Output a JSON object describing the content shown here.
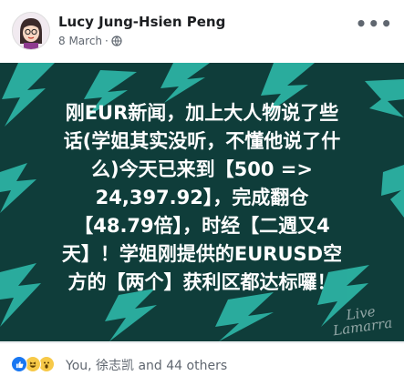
{
  "post": {
    "author": "Lucy Jung-Hsien Peng",
    "date": "8 March",
    "separator": "·",
    "privacy_icon": "globe-icon",
    "more_icon": "more-options-icon",
    "text": "刚EUR新闻，加上大人物说了些\n话(学姐其实没听，不懂他说了什\n么)今天已来到【500 =>\n24,397.92】，完成翻仓\n【48.79倍】，时经【二週又4\n天】！学姐刚提供的EURUSD空\n方的【两个】获利区都达标囉！",
    "watermark": "Live Lamarra"
  },
  "reactions": {
    "icons": [
      "like-icon",
      "haha-icon",
      "wow-icon"
    ],
    "summary": "You, 徐志凯 and 44 others"
  },
  "colors": {
    "image_bg": "#0f3d3a",
    "lightning": "#2db8a8",
    "like": "#1877f2"
  }
}
